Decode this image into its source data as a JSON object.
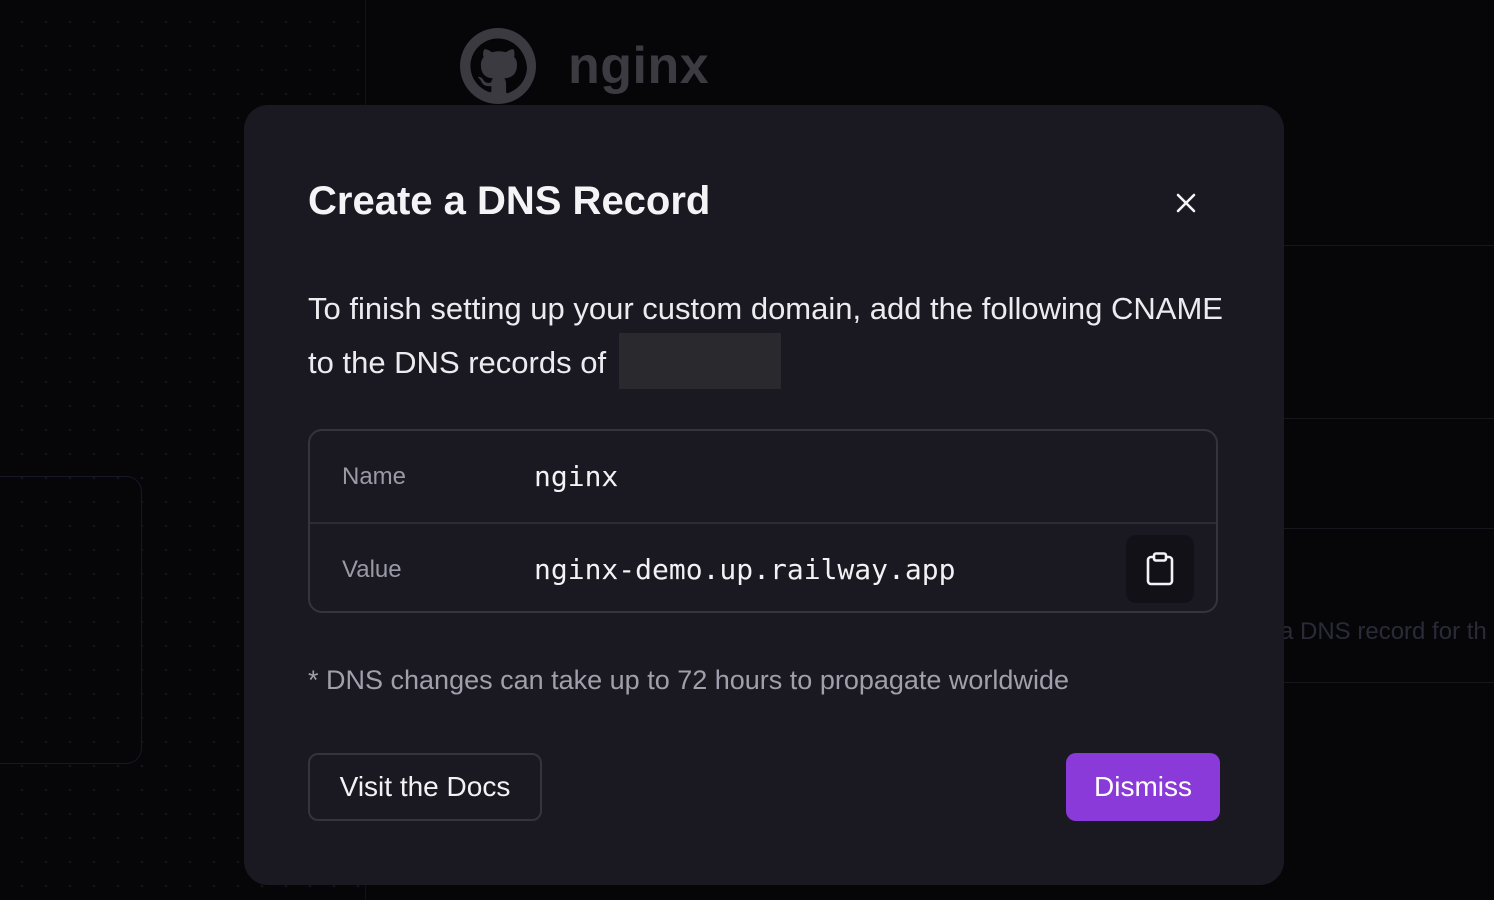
{
  "background": {
    "project_title": "nginx",
    "partial_text": "a DNS record for th"
  },
  "modal": {
    "title": "Create a DNS Record",
    "description": "To finish setting up your custom domain, add the following CNAME to the DNS records of",
    "record": {
      "name_label": "Name",
      "name_value": "nginx",
      "value_label": "Value",
      "value_value": "nginx-demo.up.railway.app"
    },
    "note": "* DNS changes can take up to 72 hours to propagate worldwide",
    "docs_button": "Visit the Docs",
    "dismiss_button": "Dismiss"
  },
  "icons": {
    "close": "close-icon",
    "copy": "clipboard-icon",
    "brand": "github-icon"
  },
  "colors": {
    "accent": "#8a3ad8",
    "modal_bg": "#1a1922",
    "page_bg": "#060609"
  }
}
